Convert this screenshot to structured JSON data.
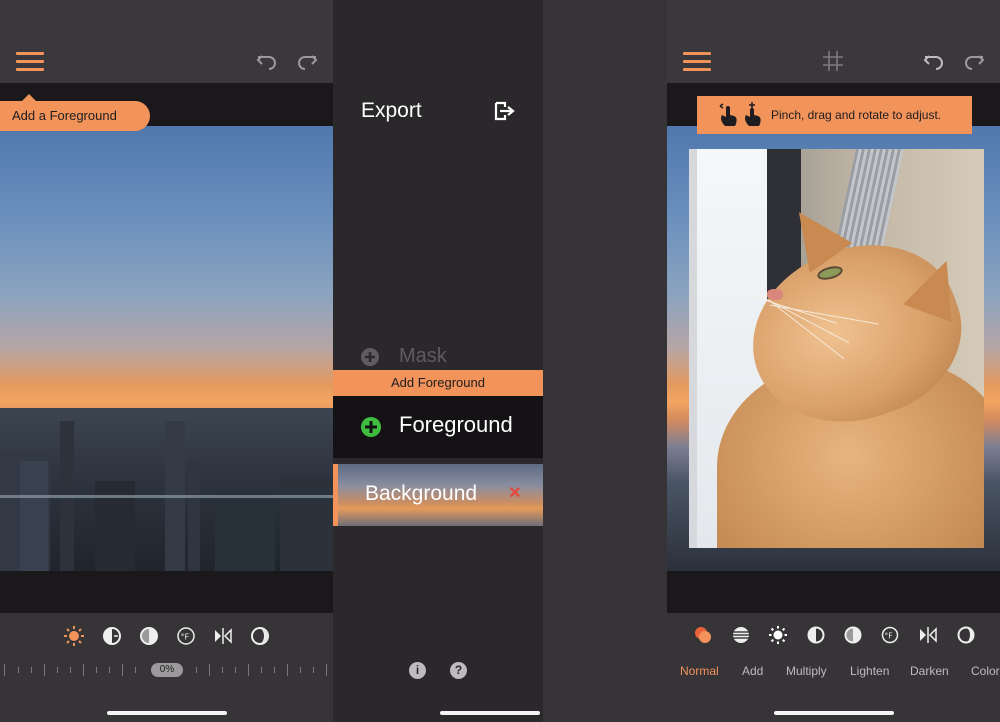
{
  "panel_left": {
    "foreground_tag": "Add a Foreground",
    "slider_value": "0%",
    "tools": [
      "brightness-icon",
      "exposure-icon",
      "contrast-icon",
      "temperature-icon",
      "flip-icon",
      "saturation-icon"
    ]
  },
  "panel_menu": {
    "export_label": "Export",
    "mask_label": "Mask",
    "add_foreground_tip": "Add Foreground",
    "foreground_label": "Foreground",
    "background_label": "Background",
    "background_remove": "×",
    "info_label": "i",
    "help_label": "?"
  },
  "panel_right": {
    "hint_text": "Pinch, drag and rotate to adjust.",
    "blend_modes": [
      "Normal",
      "Add",
      "Multiply",
      "Lighten",
      "Darken",
      "Color"
    ],
    "active_blend": "Normal"
  },
  "colors": {
    "accent": "#f2935a",
    "add_green": "#3ebd3e",
    "remove_red": "#e2463d"
  }
}
